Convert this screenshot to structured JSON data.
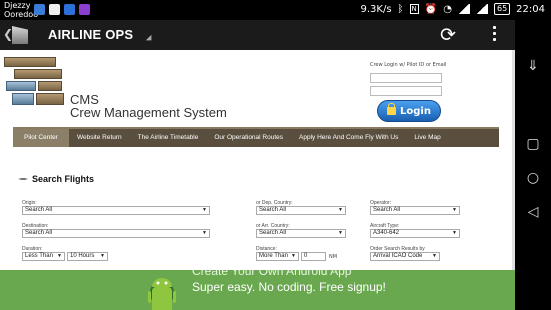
{
  "statusbar": {
    "carrier1": "Djezzy",
    "carrier2": "Ooredoo",
    "speed": "9.3K/s",
    "battery": "65",
    "time": "22:04"
  },
  "actionbar": {
    "title": "AIRLINE OPS"
  },
  "header": {
    "cms": "CMS",
    "subtitle": "Crew Management System"
  },
  "login": {
    "label": "Crew Login w/ Pilot ID or Email",
    "button": "Login"
  },
  "topnav": {
    "items": [
      "Pilot Center",
      "Website Return",
      "The Airline Timetable",
      "Our Operational Routes",
      "Apply Here And Come Fly With Us",
      "Live Map"
    ]
  },
  "search": {
    "title": "Search Flights",
    "origin_label": "Origin:",
    "origin_value": "Search All",
    "dep_country_label": "or Dep. Country:",
    "dep_country_value": "Search All",
    "operator_label": "Operator:",
    "operator_value": "Search All",
    "destination_label": "Destination:",
    "destination_value": "Search All",
    "arr_country_label": "or Arr. Country:",
    "arr_country_value": "Search All",
    "aircraft_label": "Aircraft Type:",
    "aircraft_value": "A340-642",
    "duration_label": "Duration:",
    "duration_op": "Less Than",
    "duration_value": "10 Hours",
    "distance_label": "Distance:",
    "distance_op": "More Than",
    "distance_value": "0",
    "distance_unit": "NM",
    "order_label": "Order Search Results by",
    "order_value": "Arrival ICAO Code"
  },
  "ad": {
    "line1": "Create Your Own Android App",
    "line2": "Super easy. No coding. Free signup!"
  },
  "colors": {
    "nav": "#5a4e3e",
    "ad": "#6aa84f",
    "login_btn": "#1a5fb0"
  }
}
